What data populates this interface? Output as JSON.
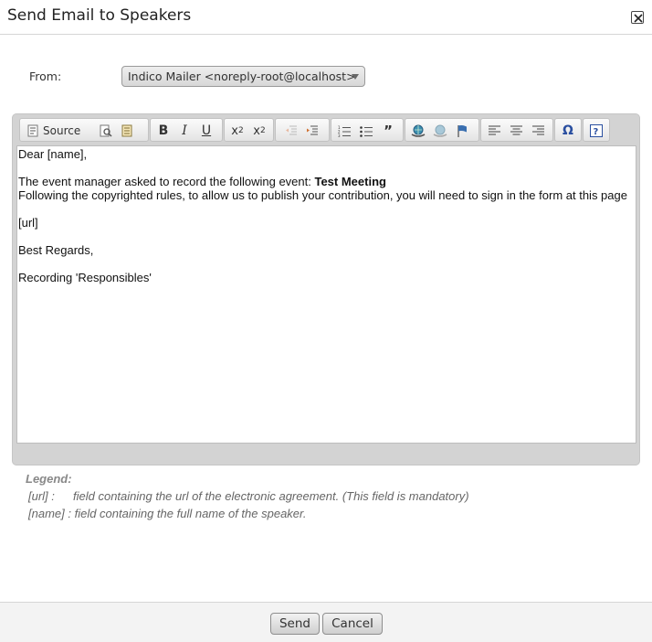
{
  "dialog": {
    "title": "Send Email to Speakers"
  },
  "from": {
    "label": "From:",
    "selected": "Indico Mailer <noreply-root@localhost>"
  },
  "toolbar": {
    "source_label": "Source",
    "buttons": [
      "source-icon",
      "preview-icon",
      "templates-icon",
      "bold-icon",
      "italic-icon",
      "underline-icon",
      "subscript-icon",
      "superscript-icon",
      "outdent-icon",
      "indent-icon",
      "numbered-list-icon",
      "bulleted-list-icon",
      "blockquote-icon",
      "link-icon",
      "unlink-icon",
      "anchor-icon",
      "align-left-icon",
      "align-center-icon",
      "align-right-icon",
      "special-char-icon",
      "about-icon"
    ]
  },
  "body": {
    "line1": "Dear [name],",
    "line2_prefix": "The event manager asked to record the following event: ",
    "line2_event": "Test Meeting",
    "line3": "Following the copyrighted rules, to allow us to publish your contribution, you will need to sign in the form at this page",
    "line4": "[url]",
    "line5": "Best Regards,",
    "line6": "Recording 'Responsibles'"
  },
  "legend": {
    "title": "Legend:",
    "url_key": "[url] :",
    "url_desc": "field containing the url of the electronic agreement. (This field is mandatory)",
    "name_key": "[name] :",
    "name_desc": "field containing the full name of the speaker."
  },
  "footer": {
    "send_label": "Send",
    "cancel_label": "Cancel"
  },
  "colors": {
    "toolbar_bg": "#d3d3d3",
    "link_icon": "#3a6fb0"
  }
}
